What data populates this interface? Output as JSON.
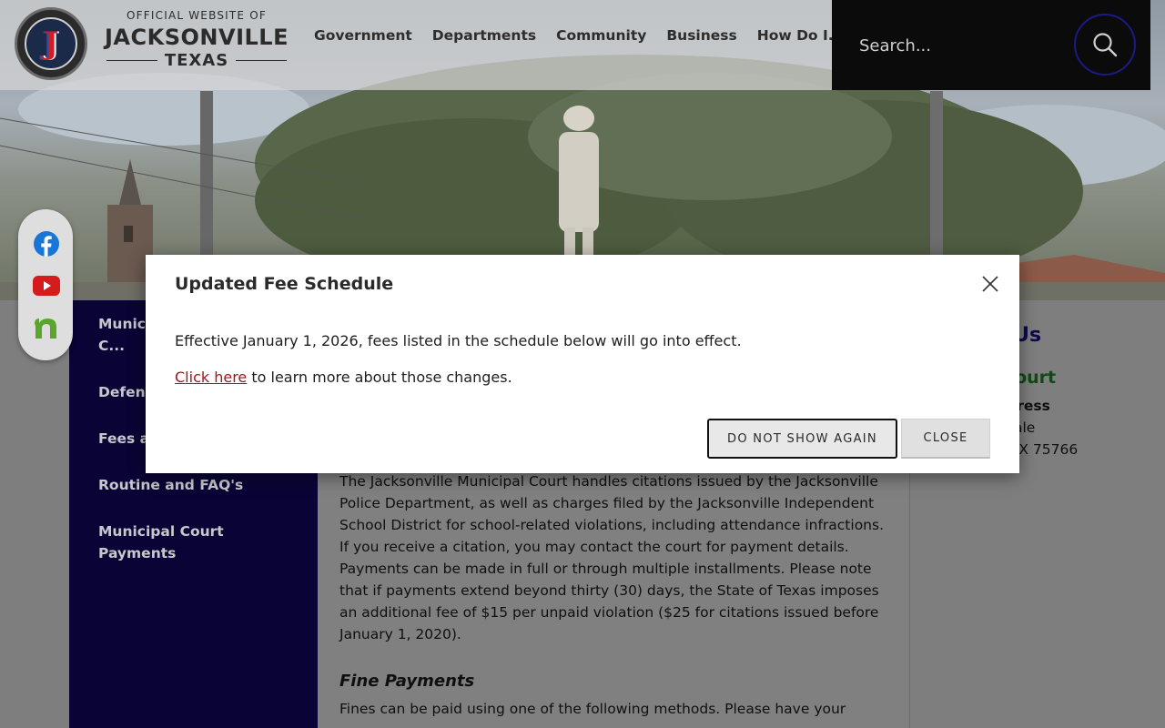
{
  "header": {
    "logo_tagline": "OFFICIAL WEBSITE OF",
    "logo_city": "JACKSONVILLE",
    "logo_state": "TEXAS",
    "nav": [
      "Government",
      "Departments",
      "Community",
      "Business",
      "How Do I..."
    ],
    "search_placeholder": "Search..."
  },
  "social": [
    "facebook-icon",
    "youtube-icon",
    "nextdoor-icon"
  ],
  "sidebar": {
    "items": [
      "Municipal Court Local C...",
      "Defens...",
      "Fees a...",
      "Routine and FAQ's",
      "Municipal Court Payments"
    ]
  },
  "main": {
    "paragraph": "The Jacksonville Municipal Court handles citations issued by the Jacksonville Police Department, as well as charges filed by the Jacksonville Independent School District for school-related violations, including attendance infractions. If you receive a citation, you may contact the court for payment details. Payments can be made in full or through multiple installments. Please note that if payments extend beyond thirty (30) days, the State of Texas imposes an additional fee of $15 per unpaid violation ($25 for citations issued before January 1, 2020).",
    "subheading": "Fine Payments",
    "paragraph2": "Fines can be paid using one of the following methods. Please have your"
  },
  "right": {
    "contact_title": "t Us",
    "court_name": "l Court",
    "address_label": "ddress",
    "address_line1": "ale",
    "address_line2": ", TX 75766"
  },
  "modal": {
    "title": "Updated Fee Schedule",
    "message": "Effective January 1, 2026, fees listed in the schedule below will go into effect.",
    "link_text": "Click here",
    "link_suffix": " to learn more about those changes.",
    "btn_dont_show": "DO NOT SHOW AGAIN",
    "btn_close": "CLOSE"
  },
  "colors": {
    "sidebar_bg": "#0a0436",
    "link_red": "#a8131b",
    "contact_blue": "#0d0a4a",
    "court_green": "#0e4a14",
    "search_bg": "#0b0b0b"
  }
}
